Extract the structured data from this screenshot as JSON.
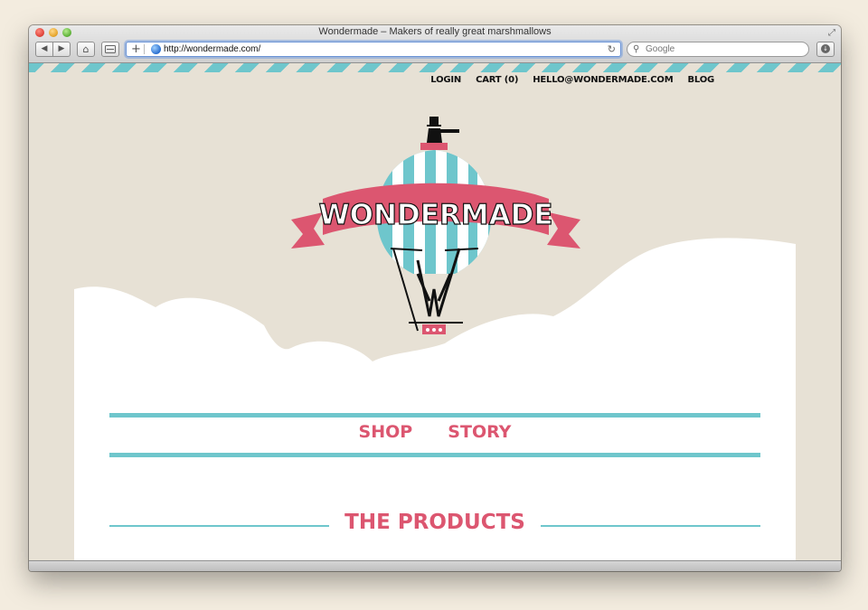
{
  "window": {
    "title": "Wondermade – Makers of really great marshmallows"
  },
  "toolbar": {
    "back_label": "◀",
    "forward_label": "▶",
    "home_label": "⌂",
    "url": "http://wondermade.com/",
    "search_placeholder": "Google"
  },
  "site": {
    "top_nav": [
      "LOGIN",
      "CART (0)",
      "HELLO@WONDERMADE.COM",
      "BLOG"
    ],
    "logo_text": "WONDERMADE",
    "main_nav": [
      "SHOP",
      "STORY"
    ],
    "section_title": "THE PRODUCTS"
  },
  "colors": {
    "accent_pink": "#dc5670",
    "accent_teal": "#6ec6cc",
    "paper": "#e7e1d5"
  },
  "icons": [
    "globe-icon",
    "reload-icon",
    "search-icon",
    "download-icon",
    "home-icon",
    "fullscreen-icon"
  ]
}
